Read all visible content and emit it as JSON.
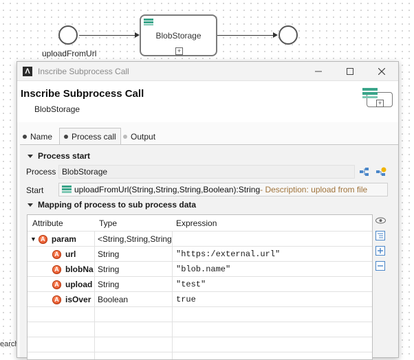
{
  "canvas": {
    "start_event_label": "uploadFromUrl",
    "task_label": "BlobStorage"
  },
  "dialog": {
    "window_title": "Inscribe Subprocess Call",
    "header_title": "Inscribe Subprocess Call",
    "header_subtitle": "BlobStorage",
    "tabs": [
      {
        "label": "Name"
      },
      {
        "label": "Process call"
      },
      {
        "label": "Output"
      }
    ],
    "process_start": {
      "section_title": "Process start",
      "process_label": "Process",
      "process_value": "BlobStorage",
      "start_label": "Start",
      "start_signature": "uploadFromUrl(String,String,String,Boolean):String",
      "start_description": " - Description: upload from file"
    },
    "mapping": {
      "section_title": "Mapping of process to sub process data",
      "columns": [
        "Attribute",
        "Type",
        "Expression"
      ],
      "rows": [
        {
          "attribute": "param",
          "type": "<String,String,String",
          "expression": ""
        },
        {
          "attribute": "url",
          "type": "String",
          "expression": "\"https:/external.url\""
        },
        {
          "attribute": "blobNa",
          "type": "String",
          "expression": "\"blob.name\""
        },
        {
          "attribute": "upload",
          "type": "String",
          "expression": "\"test\""
        },
        {
          "attribute": "isOver",
          "type": "Boolean",
          "expression": "true"
        }
      ]
    }
  },
  "background_fragment": "earch",
  "icons": {
    "app_logo": "lambda-icon",
    "subprocess": "subprocess-icon",
    "minimize": "minimize-icon",
    "maximize": "maximize-icon",
    "close": "close-icon"
  },
  "colors": {
    "description_text": "#a0733a",
    "attribute_icon": "#e04e1f",
    "accent_teal": "#3aa58a"
  }
}
